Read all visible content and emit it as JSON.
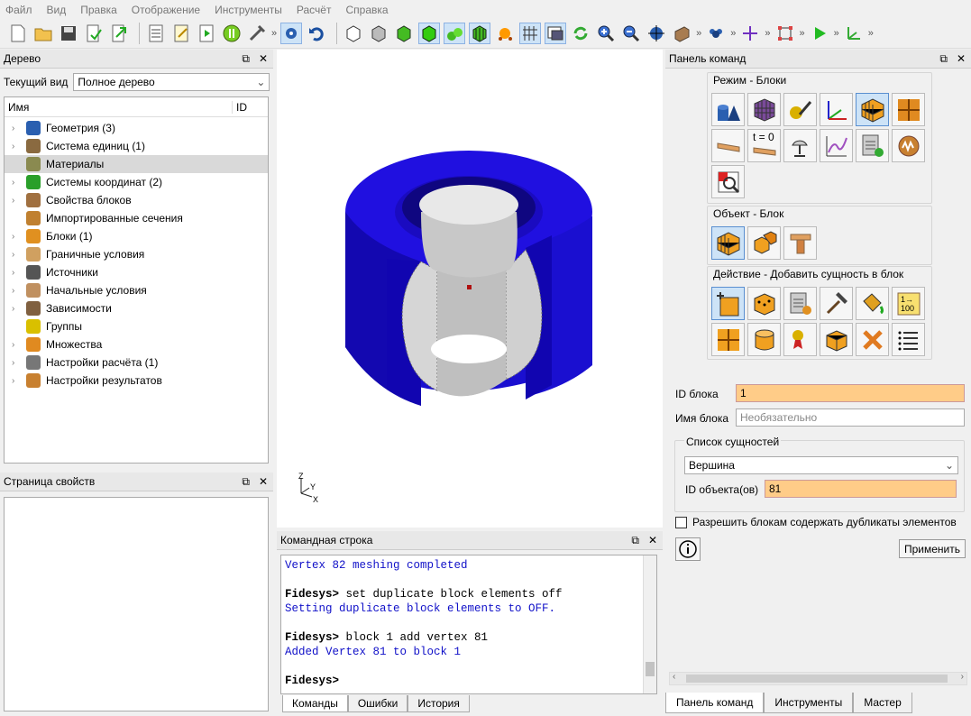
{
  "menu": [
    "Файл",
    "Вид",
    "Правка",
    "Отображение",
    "Инструменты",
    "Расчёт",
    "Справка"
  ],
  "tree_panel": {
    "title": "Дерево",
    "view_label": "Текущий вид",
    "view_value": "Полное дерево",
    "col_name": "Имя",
    "col_id": "ID",
    "items": [
      {
        "label": "Геометрия (3)",
        "icon": "geometry-icon",
        "expand": true
      },
      {
        "label": "Система единиц (1)",
        "icon": "units-icon",
        "expand": true
      },
      {
        "label": "Материалы",
        "icon": "materials-icon",
        "expand": false,
        "selected": true
      },
      {
        "label": "Системы координат (2)",
        "icon": "coordinate-systems-icon",
        "expand": true
      },
      {
        "label": "Свойства блоков",
        "icon": "block-properties-icon",
        "expand": true
      },
      {
        "label": "Импортированные сечения",
        "icon": "sections-icon",
        "expand": false
      },
      {
        "label": "Блоки (1)",
        "icon": "blocks-icon",
        "expand": true
      },
      {
        "label": "Граничные условия",
        "icon": "boundary-conditions-icon",
        "expand": true
      },
      {
        "label": "Источники",
        "icon": "sources-icon",
        "expand": true
      },
      {
        "label": "Начальные условия",
        "icon": "initial-conditions-icon",
        "expand": true
      },
      {
        "label": "Зависимости",
        "icon": "dependencies-icon",
        "expand": true
      },
      {
        "label": "Группы",
        "icon": "groups-icon",
        "expand": false
      },
      {
        "label": "Множества",
        "icon": "sets-icon",
        "expand": true
      },
      {
        "label": "Настройки расчёта (1)",
        "icon": "calc-settings-icon",
        "expand": true
      },
      {
        "label": "Настройки результатов",
        "icon": "result-settings-icon",
        "expand": true
      }
    ]
  },
  "props_panel": {
    "title": "Страница свойств"
  },
  "command_line": {
    "title": "Командная строка",
    "lines": [
      {
        "text": "Vertex 82 meshing completed",
        "kind": "out"
      },
      {
        "text": "",
        "kind": "blank"
      },
      {
        "prompt": "Fidesys>",
        "text": " set duplicate block elements off",
        "kind": "cmd"
      },
      {
        "text": "Setting duplicate block elements to OFF.",
        "kind": "out"
      },
      {
        "text": "",
        "kind": "blank"
      },
      {
        "prompt": "Fidesys>",
        "text": " block 1 add vertex 81",
        "kind": "cmd"
      },
      {
        "text": "Added Vertex 81 to block 1",
        "kind": "out"
      },
      {
        "text": "",
        "kind": "blank"
      },
      {
        "prompt": "Fidesys>",
        "text": "",
        "kind": "cmd"
      }
    ],
    "tabs": [
      "Команды",
      "Ошибки",
      "История"
    ]
  },
  "command_panel": {
    "title": "Панель команд",
    "mode_group": "Режим - Блоки",
    "object_group": "Объект - Блок",
    "action_group": "Действие - Добавить сущность в блок",
    "t0_label": "t = 0",
    "num_icon_top": "1→",
    "num_icon_bottom": "100",
    "block_id_label": "ID блока",
    "block_id_value": "1",
    "block_name_label": "Имя блока",
    "block_name_placeholder": "Необязательно",
    "entity_list_label": "Список сущностей",
    "entity_type": "Вершина",
    "object_id_label": "ID объекта(ов)",
    "object_id_value": "81",
    "duplicates_label": "Разрешить блокам содержать дубликаты элементов",
    "apply_label": "Применить",
    "bottom_tabs": [
      "Панель команд",
      "Инструменты",
      "Мастер"
    ]
  },
  "viewport": {
    "axis_z": "Z",
    "axis_y": "Y",
    "axis_x": "X"
  },
  "colors": {
    "model_blue": "#1a0fd0",
    "inner_gray": "#c8c8c8",
    "highlight": "#ffcc88"
  }
}
